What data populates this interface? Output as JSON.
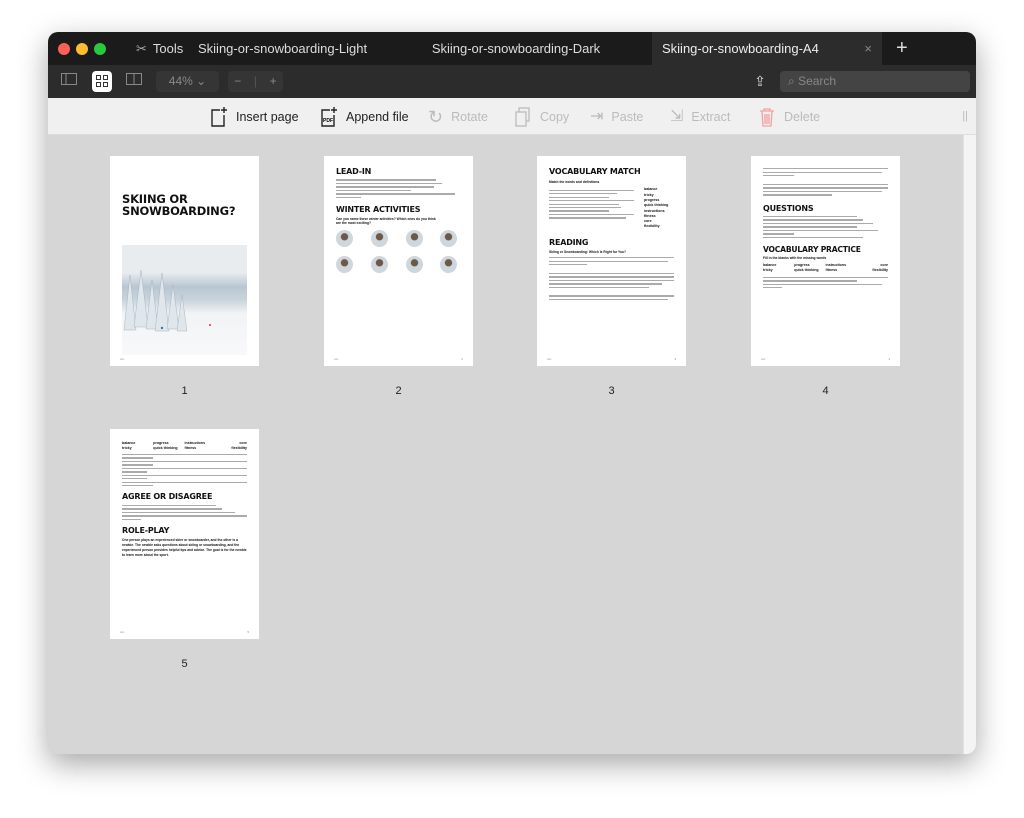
{
  "tabs": {
    "tools": "Tools",
    "items": [
      {
        "label": "Skiing-or-snowboarding-Light"
      },
      {
        "label": "Skiing-or-snowboarding-Dark"
      },
      {
        "label": "Skiing-or-snowboarding-A4",
        "active": true
      }
    ],
    "close": "×",
    "new": "+"
  },
  "toolbar": {
    "zoom": "44%",
    "zoom_out": "−",
    "zoom_in": "+",
    "search_placeholder": "Search"
  },
  "actions": {
    "insert": "Insert page",
    "append": "Append file",
    "rotate": "Rotate",
    "copy": "Copy",
    "paste": "Paste",
    "extract": "Extract",
    "delete": "Delete"
  },
  "colors": {
    "close": "#fe5f57",
    "min": "#febc2e",
    "max": "#28c840",
    "delete": "#f2a0a0"
  },
  "pages": [
    {
      "number": "1",
      "title": "SKIING OR SNOWBOARDING?"
    },
    {
      "number": "2",
      "h1": "LEAD-IN",
      "h2": "WINTER ACTIVITIES",
      "sub": "Can you name these winter activities? Which ones do you think are the most exciting?"
    },
    {
      "number": "3",
      "h1": "VOCABULARY MATCH",
      "sub1": "Match the words and definitions",
      "words": [
        "balance",
        "tricky",
        "progress",
        "quick thinking",
        "instructions",
        "fitness",
        "core",
        "flexibility"
      ],
      "h2": "READING",
      "sub2": "Skiing or Snowboarding: Which Is Right for You?"
    },
    {
      "number": "4",
      "h1": "QUESTIONS",
      "h2": "VOCABULARY PRACTICE",
      "sub": "Fill in the blanks with the missing words",
      "words": [
        "balance",
        "progress",
        "instructions",
        "core",
        "tricky",
        "quick thinking",
        "fitness",
        "flexibility"
      ]
    },
    {
      "number": "5",
      "words": [
        "balance",
        "progress",
        "instructions",
        "core",
        "tricky",
        "quick thinking",
        "fitness",
        "flexibility"
      ],
      "h1": "AGREE OR DISAGREE",
      "h2": "ROLE-PLAY",
      "body": "One person plays an experienced skier or snowboarder, and the other is a newbie. The newbie asks questions about skiing or snowboarding, and the experienced person provides helpful tips and advice. The goal is for the newbie to learn more about the sport."
    }
  ]
}
